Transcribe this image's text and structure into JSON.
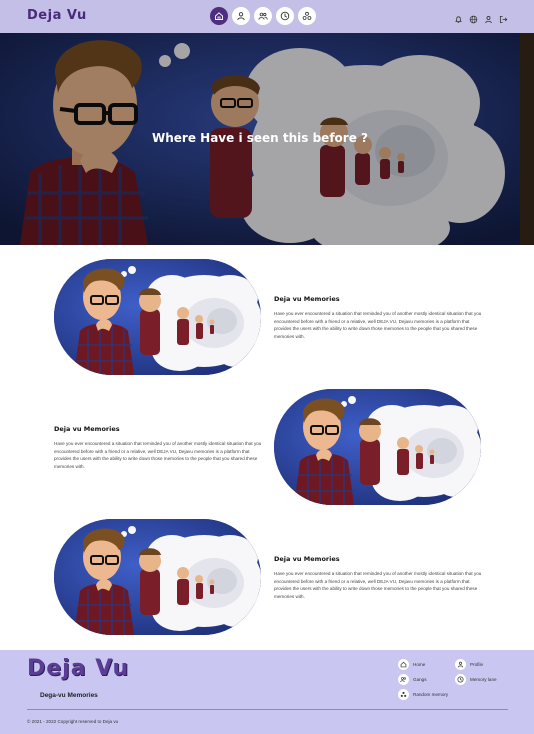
{
  "navbar": {
    "brand": "Deja Vu",
    "center_icons": [
      "home-icon",
      "user-icon",
      "group-icon",
      "clock-icon",
      "random-icon"
    ],
    "right_icons": [
      "bell-icon",
      "globe-icon",
      "user-icon",
      "logout-icon"
    ]
  },
  "hero": {
    "title": "Where Have i seen this before ?"
  },
  "features": [
    {
      "title": "Deja vu Memories",
      "body": "Have you ever encountered a situation that reminded you of another mostly identical situation that you encountered before with a friend or a relative, well DEJA VU, Dejavu memories is a platform that provides the users with the ability to write down those memories to the people that you shared these memories with."
    },
    {
      "title": "Deja vu Memories",
      "body": "Have you ever encountered a situation that reminded you of another mostly identical situation that you encountered before with a friend or a relative, well DEJA VU, Dejavu memories is a platform that provides the users with the ability to write down those memories to the people that you shared these memories with."
    },
    {
      "title": "Deja vu Memories",
      "body": "Have you ever encountered a situation that reminded you of another mostly identical situation that you encountered before with a friend or a relative, well DEJA VU, Dejavu memories is a platform that provides the users with the ability to write down those memories to the people that you shared these memories with."
    }
  ],
  "footer": {
    "logo": "Deja Vu",
    "subtitle": "Dega-vu Memories",
    "links": {
      "home": "Home",
      "profile": "Profile",
      "gangs": "Gangs",
      "memory_lane": "Memory lane",
      "random_memory": "Random memory"
    },
    "copyright": "© 2021 - 2022 Copyright reserved to Deja vu"
  },
  "colors": {
    "navbar_bg": "#c3bfe6",
    "brand": "#4a2a7a",
    "active_nav": "#4e2e7d",
    "footer_bg": "#c9c6f1",
    "image_bg": "#233a8f"
  }
}
